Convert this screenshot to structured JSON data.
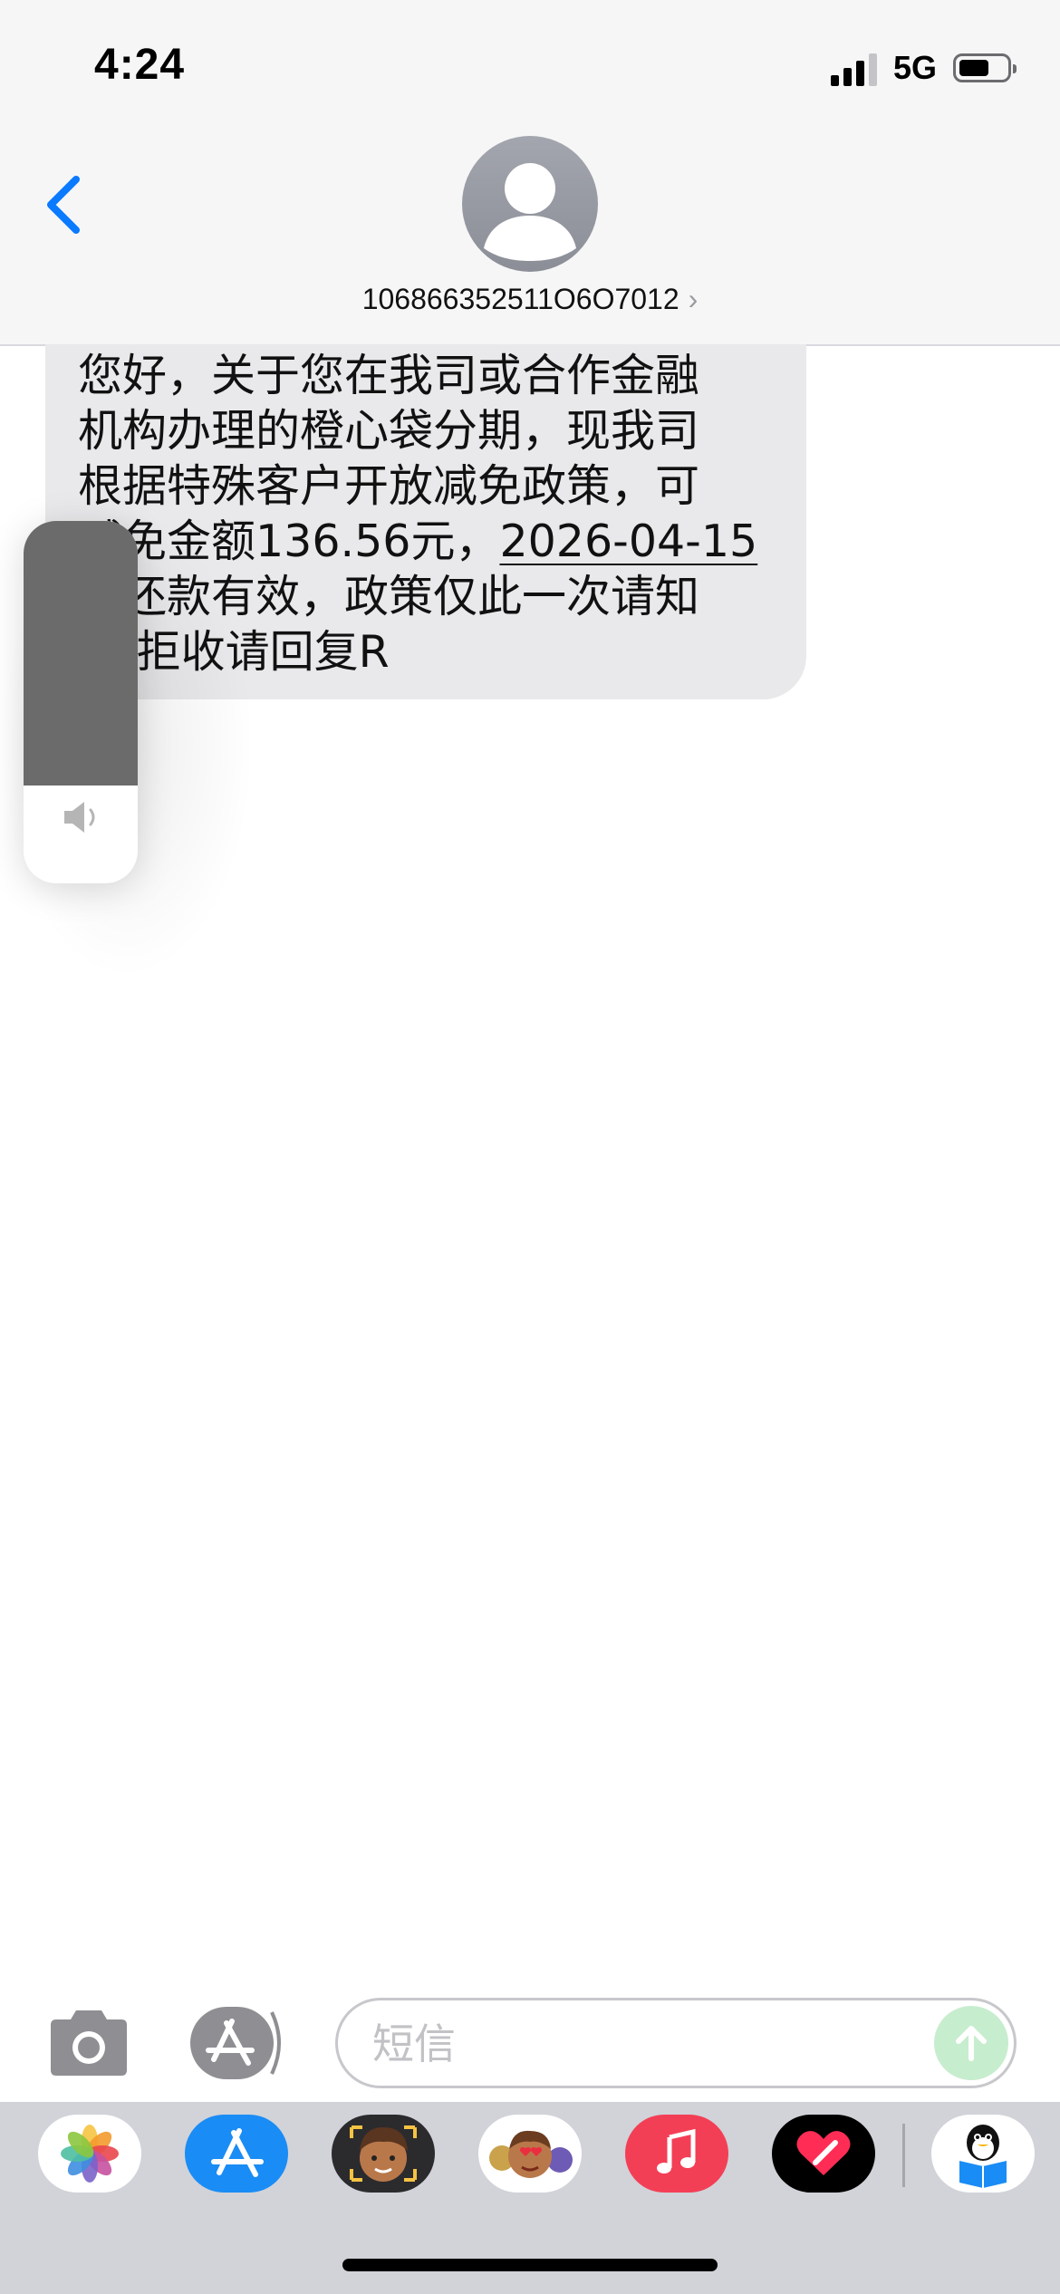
{
  "status_bar": {
    "time": "4:24",
    "network": "5G",
    "battery_level": 0.62
  },
  "header": {
    "contact": "106866352511O6O7012",
    "back_icon": "chevron-left-icon",
    "avatar_icon": "person-silhouette-icon",
    "chevron": "›"
  },
  "message": {
    "line1": "您好，关于您在我司或合作金融",
    "line2": "机构办理的橙心袋分期，现我司",
    "line3": "根据特殊客户开放减免政策，可",
    "line4_prefix": "减免金额136.56元，",
    "line4_date": "2026-04-15",
    "line5": "前还款有效，政策仅此一次请知",
    "line6": "悉 拒收请回复R"
  },
  "volume_hud": {
    "level": 0.73,
    "icon": "speaker-icon"
  },
  "composer": {
    "placeholder": "短信",
    "value": "",
    "camera_icon": "camera-icon",
    "apps_icon": "app-store-icon",
    "send_icon": "arrow-up-icon"
  },
  "app_drawer": {
    "apps": [
      "photos-icon",
      "app-store-icon",
      "memoji-icon",
      "animoji-icon",
      "music-icon",
      "digital-touch-icon",
      "qq-icon"
    ]
  },
  "colors": {
    "accent": "#0a7aff",
    "bubble": "#e9e9eb",
    "send_disabled": "#c7edcf",
    "music": "#f33f56",
    "app_store": "#1a8cf5"
  }
}
